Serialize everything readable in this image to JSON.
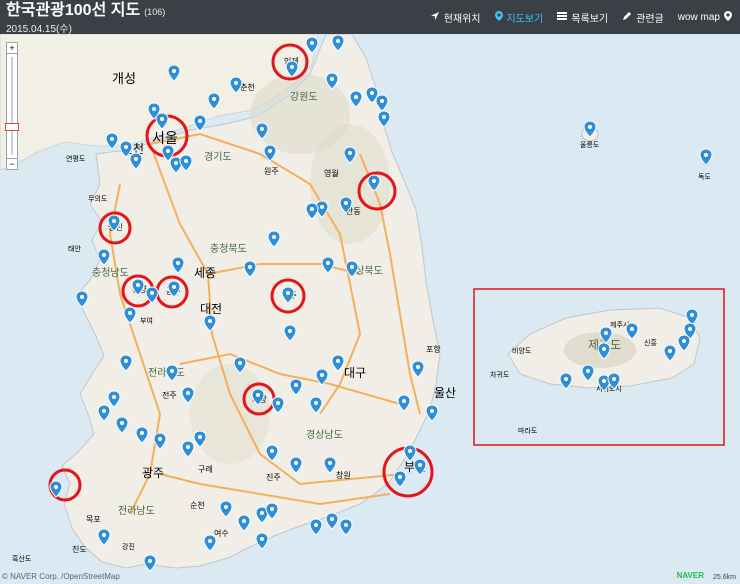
{
  "header": {
    "title": "한국관광100선 지도",
    "count": "(106)",
    "date": "2015.04.15(수)"
  },
  "nav": [
    {
      "label": "현재위치",
      "icon": "navigation-icon",
      "active": false
    },
    {
      "label": "지도보기",
      "icon": "map-pin-icon",
      "active": true
    },
    {
      "label": "목록보기",
      "icon": "list-icon",
      "active": false
    },
    {
      "label": "관련글",
      "icon": "edit-icon",
      "active": false
    },
    {
      "label": "wow map",
      "icon": "map-pin-icon",
      "active": false
    }
  ],
  "map": {
    "water_color": "#dbe9f2",
    "land_color": "#f0eee6",
    "highlight_color": "#e5141b",
    "marker_color": "#2f8ed8",
    "labels": [
      "개성",
      "서울",
      "인천",
      "강원도",
      "경기도",
      "춘천",
      "원주",
      "충청북도",
      "충청남도",
      "세종",
      "대전",
      "경상북도",
      "울릉도",
      "독도",
      "포항",
      "대구",
      "울산",
      "부산",
      "경상남도",
      "전라북도",
      "전주",
      "광주",
      "전라남도",
      "목포",
      "제주도",
      "제주시",
      "서귀포시",
      "마라도",
      "청양",
      "공주",
      "당진",
      "상주",
      "거창",
      "인제",
      "영월",
      "안동",
      "창원",
      "여수",
      "순천",
      "진주",
      "구례",
      "진도"
    ],
    "extra_labels": [
      "비양도",
      "차귀도",
      "신흥",
      "연평도",
      "무의도",
      "태안",
      "부여",
      "강진",
      "흑산도"
    ],
    "footer": "© NAVER Corp. /OpenStreetMap",
    "naver_logo": "NAVER",
    "scale": "25.6km"
  }
}
